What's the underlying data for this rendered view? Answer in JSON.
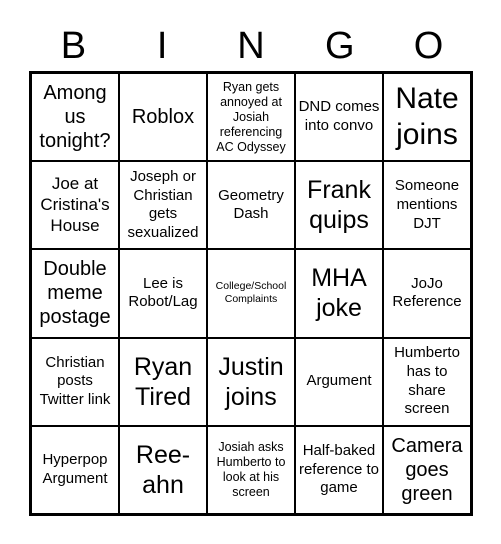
{
  "header": [
    "B",
    "I",
    "N",
    "G",
    "O"
  ],
  "cells": [
    "Among us tonight?",
    "Roblox",
    "Ryan gets annoyed at Josiah referencing AC Odyssey",
    "DND comes into convo",
    "Nate joins",
    "Joe at Cristina's House",
    "Joseph or Christian gets sexualized",
    "Geometry Dash",
    "Frank quips",
    "Someone mentions DJT",
    "Double meme postage",
    "Lee is Robot/Lag",
    "College/School Complaints",
    "MHA joke",
    "JoJo Reference",
    "Christian posts Twitter link",
    "Ryan Tired",
    "Justin joins",
    "Argument",
    "Humberto has to share screen",
    "Hyperpop Argument",
    "Ree-ahn",
    "Josiah asks Humberto to look at his screen",
    "Half-baked reference to game",
    "Camera goes green"
  ]
}
